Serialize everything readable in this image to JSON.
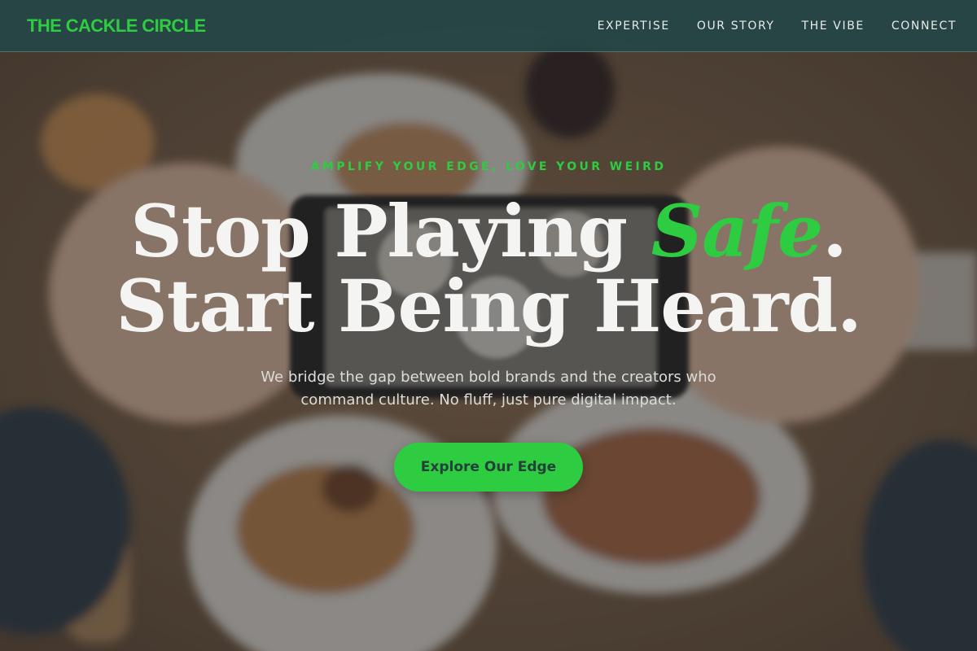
{
  "brand": {
    "name": "THE CACKLE CIRCLE",
    "accent_color": "#2ecc40"
  },
  "nav": {
    "items": [
      {
        "label": "EXPERTISE"
      },
      {
        "label": "OUR STORY"
      },
      {
        "label": "THE VIBE"
      },
      {
        "label": "CONNECT"
      }
    ]
  },
  "hero": {
    "eyebrow": "AMPLIFY YOUR EDGE, LOVE YOUR WEIRD",
    "headline_line1_prefix": "Stop Playing ",
    "headline_accent": "Safe",
    "headline_line1_suffix": ".",
    "headline_line2": "Start Being Heard.",
    "subtext": "We bridge the gap between bold brands and the creators who command culture. No fluff, just pure digital impact.",
    "cta_label": "Explore Our Edge",
    "background_image": "hands-holding-phone-over-food-table"
  }
}
